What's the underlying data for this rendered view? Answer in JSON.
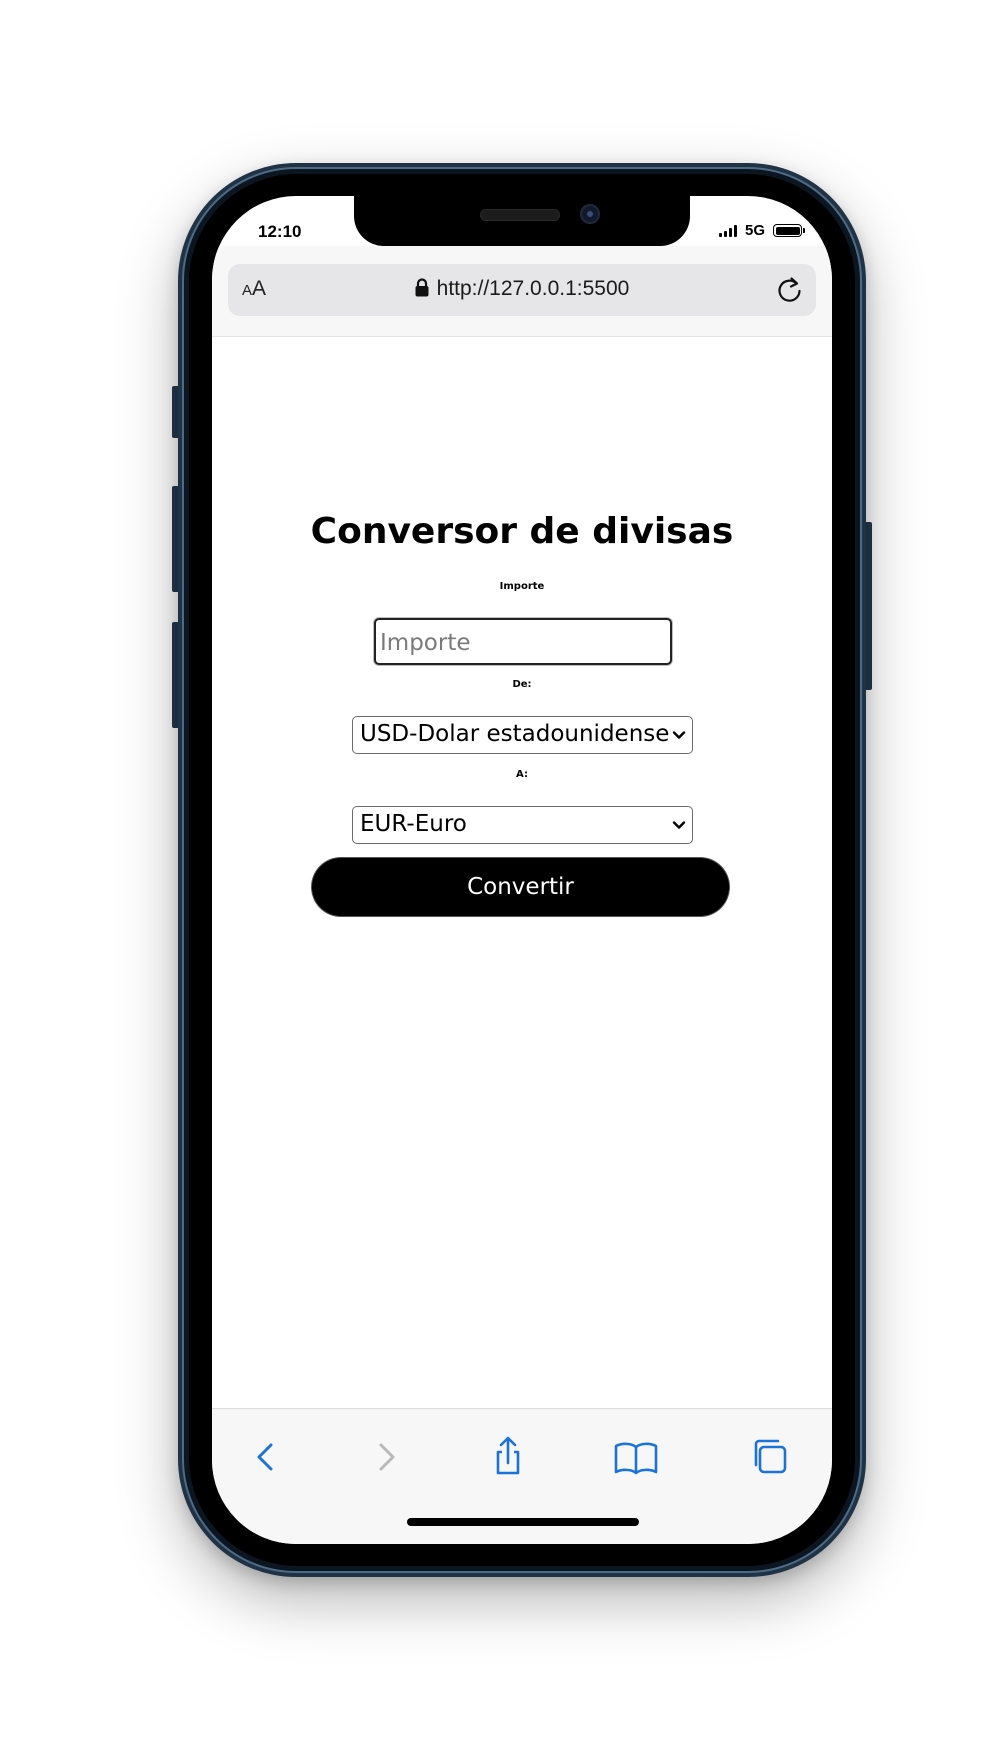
{
  "status_bar": {
    "time": "12:10",
    "network": "5G",
    "battery_level": 1.0
  },
  "browser": {
    "text_size_small": "A",
    "text_size_large": "A",
    "url": "http://127.0.0.1:5500",
    "icons": [
      "lock-icon",
      "reload-icon",
      "back-icon",
      "forward-icon",
      "share-icon",
      "bookmarks-icon",
      "tabs-icon"
    ]
  },
  "page": {
    "title": "Conversor de divisas",
    "amount": {
      "label": "Importe",
      "placeholder": "Importe",
      "value": ""
    },
    "from": {
      "label": "De:",
      "selected": "USD-Dolar estadounidense"
    },
    "to": {
      "label": "A:",
      "selected": "EUR-Euro"
    },
    "convert_label": "Convertir"
  },
  "colors": {
    "ios_blue": "#1a73d9",
    "disabled_gray": "#b9b9b9",
    "button_bg": "#000000",
    "button_text": "#ffffff",
    "frame_blue": "#203345"
  }
}
